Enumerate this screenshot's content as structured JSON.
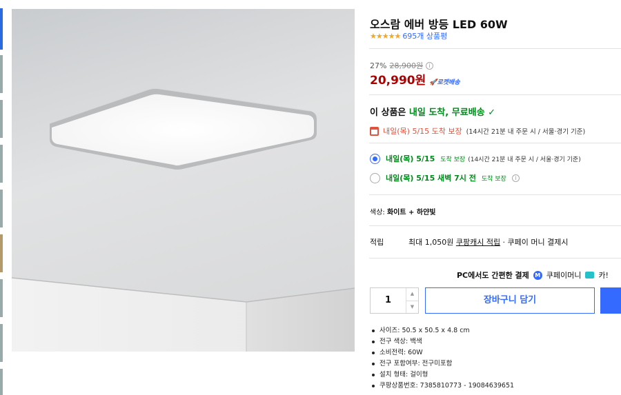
{
  "product": {
    "title": "오스람 에버 방등 LED 60W",
    "stars": "★★★★★",
    "review_count": "695개 상품평"
  },
  "pricing": {
    "discount": "27%",
    "original_price": "28,900원",
    "price": "20,990원",
    "rocket_badge": "로켓배송"
  },
  "delivery": {
    "headline_prefix": "이 상품은 ",
    "headline_green": "내일 도착, 무료배송",
    "headline_check": "✓",
    "calendar_red": "내일(목) 5/15 도착 보장",
    "calendar_detail": "(14시간 21분  내 주문 시 / 서울·경기 기준)",
    "options": [
      {
        "bold": "내일(목) 5/15",
        "mid": "도착 보장",
        "detail": "(14시간 21분 내 주문 시 / 서울·경기 기준)",
        "selected": true
      },
      {
        "bold": "내일(목) 5/15 새벽 7시 전",
        "mid": "도착 보장",
        "detail": "",
        "selected": false
      }
    ]
  },
  "option": {
    "label": "색상:",
    "value": "화이트 + 하얀빛"
  },
  "points": {
    "label": "적립",
    "text_prefix": "최대 1,050원 ",
    "text_link": "쿠팡캐시 적립",
    "text_suffix": " · 쿠페이 머니 결제시"
  },
  "payment": {
    "text": "PC에서도 간편한 결제",
    "coupay": "쿠페이머니",
    "card": "카!"
  },
  "purchase": {
    "quantity": "1",
    "cart_label": "장바구니 담기"
  },
  "specs": [
    "사이즈: 50.5 x 50.5 x 4.8 cm",
    "전구 색상: 백색",
    "소비전력: 60W",
    "전구 포함여부: 전구미포함",
    "설치 형태: 걸이형",
    "쿠팡상품번호: 7385810773 - 19084639651"
  ],
  "colors": {
    "price_red": "#ae0000",
    "coupang_blue": "#346aff",
    "delivery_green": "#00891a",
    "star_orange": "#f5a623"
  }
}
